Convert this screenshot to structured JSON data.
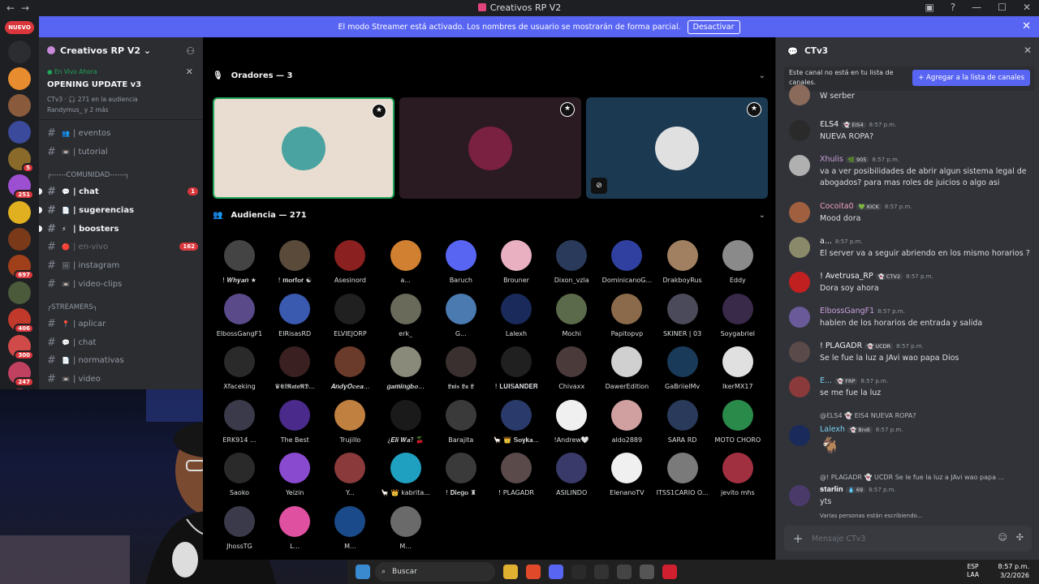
{
  "window": {
    "title": "Creativos RP V2"
  },
  "servers": {
    "new_label": "NUEVO",
    "items": [
      {
        "color": "#2b2d31",
        "count": ""
      },
      {
        "color": "#e88d2f",
        "count": ""
      },
      {
        "color": "#8a5a3c",
        "count": ""
      },
      {
        "color": "#3b4a9b",
        "count": ""
      },
      {
        "color": "#8a6a2b",
        "count": "5"
      },
      {
        "color": "#9d4fd1",
        "count": "251"
      },
      {
        "color": "#e0b020",
        "count": ""
      },
      {
        "color": "#7a3a1a",
        "count": ""
      },
      {
        "color": "#a0401a",
        "count": "697"
      },
      {
        "color": "#4a5a3a",
        "count": ""
      },
      {
        "color": "#c0392b",
        "count": "406"
      },
      {
        "color": "#d14a4a",
        "count": "300"
      },
      {
        "color": "#c04060",
        "count": "247"
      },
      {
        "color": "#a03040",
        "count": ""
      }
    ]
  },
  "banner": {
    "text": "El modo Streamer está activado. Los nombres de usuario se mostrarán de forma parcial.",
    "button": "Desactivar"
  },
  "sidebar": {
    "server_name": "Creativos RP V2",
    "live": {
      "status": "En Vivo Ahora",
      "event": "OPENING UPDATE v3",
      "meta": "CTv3 · 🎧 271 en la audiencia",
      "people": "Randymus_ y 2 más"
    },
    "channels": [
      {
        "emoji": "👥",
        "name": "| eventos",
        "style": "",
        "badge": ""
      },
      {
        "emoji": "📼",
        "name": "| tutorial",
        "style": "",
        "badge": ""
      },
      {
        "emoji": "💬",
        "name": "| chat",
        "style": "bold",
        "badge": "1"
      },
      {
        "emoji": "📄",
        "name": "| sugerencias",
        "style": "bold",
        "badge": ""
      },
      {
        "emoji": "⚡",
        "name": "| boosters",
        "style": "bold",
        "badge": ""
      },
      {
        "emoji": "🔴",
        "name": "| en-vivo",
        "style": "dim",
        "badge": "162"
      },
      {
        "emoji": "🖼",
        "name": "| instagram",
        "style": "",
        "badge": ""
      },
      {
        "emoji": "📼",
        "name": "| video-clips",
        "style": "",
        "badge": ""
      },
      {
        "emoji": "📍",
        "name": "| aplicar",
        "style": "",
        "badge": ""
      },
      {
        "emoji": "💬",
        "name": "| chat",
        "style": "",
        "badge": ""
      },
      {
        "emoji": "📄",
        "name": "| normativas",
        "style": "",
        "badge": ""
      },
      {
        "emoji": "📼",
        "name": "| video",
        "style": "",
        "badge": ""
      }
    ],
    "categories": [
      "┌------COMUNIDAD------┐",
      "┌STREAMERS┐"
    ]
  },
  "stage": {
    "speakers_header": "Oradores — 3",
    "audience_header": "Audiencia — 271",
    "speakers": [
      {
        "bg": "#e8ddd0",
        "avatar": "#4aa3a0"
      },
      {
        "bg": "#2a1a22",
        "avatar": "#7a2040"
      },
      {
        "bg": "#1b3a52",
        "avatar": "#e0e0e0"
      }
    ],
    "audience": [
      {
        "name": "! 𝑾𝒉𝒚𝒂𝒏 ★",
        "color": "#444"
      },
      {
        "name": "! 𝐦𝐨𝐫𝐟𝐨𝐫 ☯",
        "color": "#5a4a3a"
      },
      {
        "name": "Asesinord",
        "color": "#8a2020"
      },
      {
        "name": "a...",
        "color": "#d08030"
      },
      {
        "name": "Baruch",
        "color": "#5865f2"
      },
      {
        "name": "Brouner",
        "color": "#e8b0c0"
      },
      {
        "name": "Dixon_vzla",
        "color": "#2a3a5a"
      },
      {
        "name": "DominicanoG...",
        "color": "#3040a0"
      },
      {
        "name": "DrakboyRus",
        "color": "#a08060"
      },
      {
        "name": "Eddy",
        "color": "#8a8a8a"
      },
      {
        "name": "ElbossGangF1",
        "color": "#5a4a8a"
      },
      {
        "name": "ElRisasRD",
        "color": "#3a5ab0"
      },
      {
        "name": "ELVIEJORP",
        "color": "#202020"
      },
      {
        "name": "erk_",
        "color": "#6a6a5a"
      },
      {
        "name": "G...",
        "color": "#4a7ab0"
      },
      {
        "name": "Lalexh",
        "color": "#1a2a5a"
      },
      {
        "name": "Mochi",
        "color": "#5a6a4a"
      },
      {
        "name": "Papitopvp",
        "color": "#8a6a4a"
      },
      {
        "name": "SKINER | 03",
        "color": "#4a4a5a"
      },
      {
        "name": "Soygabriel",
        "color": "#3a2a4a"
      },
      {
        "name": "Xfaceking",
        "color": "#2a2a2a"
      },
      {
        "name": "♛𝕰𝖑𝕽𝖆𝖙𝖔𝕽𝕯...",
        "color": "#3a2020"
      },
      {
        "name": "𝑨𝒏𝒅𝒚𝑶𝒄𝒆𝒂...",
        "color": "#6a3a2a"
      },
      {
        "name": "𝒈𝒂𝒎𝒊𝒏𝒈𝒃𝒐...",
        "color": "#8a8a7a"
      },
      {
        "name": "𝕷𝖚𝖎𝖘 𝕷𝖆 𝕷",
        "color": "#3a3030"
      },
      {
        "name": "! 𝐋𝐔𝐈𝐒𝐀𝐍𝐃𝐄𝐑",
        "color": "#202020"
      },
      {
        "name": "Chivaxx",
        "color": "#4a3a3a"
      },
      {
        "name": "DawerEdition",
        "color": "#d0d0d0"
      },
      {
        "name": "GaBriielMv",
        "color": "#1a3a5a"
      },
      {
        "name": "IkerMX17",
        "color": "#e0e0e0"
      },
      {
        "name": "ERK914 ...",
        "color": "#3a3a4a"
      },
      {
        "name": "The Best",
        "color": "#4a2a8a"
      },
      {
        "name": "Trujillo",
        "color": "#c08040"
      },
      {
        "name": "¿𝑬𝒍𝒊 𝑾𝒂? 🍒",
        "color": "#1a1a1a"
      },
      {
        "name": "Barajita",
        "color": "#3a3a3a"
      },
      {
        "name": "🦙 👑 𝐒𝐨𝐲𝐤𝐚...",
        "color": "#2a3a6a"
      },
      {
        "name": "!Andrew🤍",
        "color": "#f0f0f0"
      },
      {
        "name": "aldo2889",
        "color": "#d0a0a0"
      },
      {
        "name": "SARA RD",
        "color": "#2a3a5a"
      },
      {
        "name": "MOTO CHORO",
        "color": "#2a8a4a"
      },
      {
        "name": "Saoko",
        "color": "#2a2a2a"
      },
      {
        "name": "Yeizin",
        "color": "#8a4ad0"
      },
      {
        "name": "Y...",
        "color": "#8a3a3a"
      },
      {
        "name": "🦙 👑 kabrita...",
        "color": "#20a0c0"
      },
      {
        "name": "! 𝐃𝐢𝐞𝐠𝐨 ♜",
        "color": "#3a3a3a"
      },
      {
        "name": "! PLAGADR",
        "color": "#5a4a4a"
      },
      {
        "name": "ASILINDO",
        "color": "#3a3a6a"
      },
      {
        "name": "ElenanoTV",
        "color": "#f0f0f0"
      },
      {
        "name": "ITSS1CARIO O...",
        "color": "#7a7a7a"
      },
      {
        "name": "jevito mhs",
        "color": "#a03040"
      },
      {
        "name": "JhossTG",
        "color": "#3a3a4a"
      },
      {
        "name": "L...",
        "color": "#e050a0"
      },
      {
        "name": "M...",
        "color": "#1a4a8a"
      },
      {
        "name": "M...",
        "color": "#6a6a6a"
      }
    ]
  },
  "chat": {
    "channel": "CTv3",
    "notice": "Este canal no está en tu lista de canales.",
    "add_button": "Agregar a la lista de canales",
    "messages": [
      {
        "author": "",
        "tags": "",
        "time": "",
        "text": "W serber",
        "avatar": "#8a6a5a",
        "color": "#f2f3f5"
      },
      {
        "author": "ƐLS4",
        "tags": "👻 EIS4",
        "time": "8:57 p.m.",
        "text": "NUEVA ROPA?",
        "avatar": "#2a2a2a",
        "color": "#f2f3f5"
      },
      {
        "author": "Xhulis",
        "tags": "🌿 905",
        "time": "8:57 p.m.",
        "text": "va a ver posibilidades de abrir algun sistema legal de abogados? para mas roles de juicios o algo asi",
        "avatar": "#b0b0b0",
        "color": "#c9a0dc"
      },
      {
        "author": "Cocoita0",
        "tags": "💚 KICK",
        "time": "8:57 p.m.",
        "text": "Mood dora",
        "avatar": "#a06040",
        "color": "#f0a0c0"
      },
      {
        "author": "a...",
        "tags": "",
        "time": "8:57 p.m.",
        "text": "El server va a seguir abriendo en los mismo horarios ?",
        "avatar": "#8a8a6a",
        "color": "#f2f3f5"
      },
      {
        "author": "! Avetrusa_RP",
        "tags": "👻 CTV2",
        "time": "8:57 p.m.",
        "text": "Dora soy ahora",
        "avatar": "#c02020",
        "color": "#f2f3f5"
      },
      {
        "author": "ElbossGangF1",
        "tags": "",
        "time": "8:57 p.m.",
        "text": "hablen de los horarios de entrada y  salida",
        "avatar": "#6a5a9a",
        "color": "#c9a0dc"
      },
      {
        "author": "! PLAGADR",
        "tags": "👻 UCDR",
        "time": "8:57 p.m.",
        "text": "Se le fue la luz a JAvi wao papa Dios",
        "avatar": "#5a4a4a",
        "color": "#f2f3f5"
      },
      {
        "author": "E...",
        "tags": "👻 FRP",
        "time": "8:57 p.m.",
        "text": "se me fue la luz",
        "avatar": "#8a3a3a",
        "color": "#7ad0f0"
      },
      {
        "author": "Lalexh",
        "tags": "👻 Bndi",
        "time": "8:57 p.m.",
        "text": "🐐",
        "avatar": "#1a2a5a",
        "color": "#7ad0f0"
      },
      {
        "author": "𝐬𝐭𝐚𝐫𝐥𝐢𝐧",
        "tags": "💧 69",
        "time": "8:57 p.m.",
        "text": "yts",
        "avatar": "#4a3a6a",
        "color": "#f2f3f5"
      }
    ],
    "replies": [
      "@ƐLS4  👻 EIS4  NUEVA ROPA?",
      "@! PLAGADR  👻 UCDR  Se le fue la luz a JAvi wao papa ..."
    ],
    "typing": "Varias personas están escribiendo...",
    "input_placeholder": "Mensaje CTv3"
  },
  "taskbar": {
    "search": "Buscar",
    "lang": "ESP\nLAA",
    "time": "8:57 p.m.",
    "date": "3/2/2026"
  }
}
